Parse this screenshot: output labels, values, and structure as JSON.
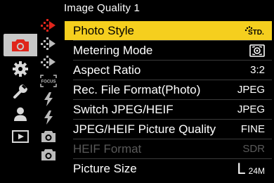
{
  "header": {
    "title": "Image Quality 1"
  },
  "tabs": [
    {
      "icon": "camera-icon",
      "active": true
    },
    {
      "icon": "gear-icon",
      "active": false
    },
    {
      "icon": "wrench-icon",
      "active": false
    },
    {
      "icon": "person-icon",
      "active": false
    },
    {
      "icon": "playback-icon",
      "active": false
    }
  ],
  "menu": {
    "items": [
      {
        "label": "Photo Style",
        "value_icon": "photo-style-standard-icon",
        "value": "STD.",
        "selected": true,
        "disabled": false
      },
      {
        "label": "Metering Mode",
        "value_icon": "multi-metering-icon",
        "value": "",
        "selected": false,
        "disabled": false
      },
      {
        "label": "Aspect Ratio",
        "value": "3:2",
        "selected": false,
        "disabled": false
      },
      {
        "label": "Rec. File Format(Photo)",
        "value": "JPEG",
        "selected": false,
        "disabled": false
      },
      {
        "label": "Switch JPEG/HEIF",
        "value": "JPEG",
        "selected": false,
        "disabled": false
      },
      {
        "label": "JPEG/HEIF Picture Quality",
        "value": "FINE",
        "selected": false,
        "disabled": false
      },
      {
        "label": "HEIF Format",
        "value": "SDR",
        "selected": false,
        "disabled": true
      },
      {
        "label": "Picture Size",
        "value_large": "L",
        "value_small": "24M",
        "selected": false,
        "disabled": false
      }
    ]
  },
  "sidebar_subicons": [
    {
      "icon": "photo-style-icon"
    },
    {
      "icon": "image-quality-icon"
    },
    {
      "icon": "image-quality-icon"
    },
    {
      "icon": "focus-icon"
    },
    {
      "icon": "flash-icon"
    },
    {
      "icon": "flash-icon"
    },
    {
      "icon": "camera-body-icon"
    },
    {
      "icon": "camera-body-icon"
    }
  ],
  "colors": {
    "accent_red": "#e0251b",
    "selection_yellow": "#f5cf1e",
    "tab_active_bg": "#c8c8c8",
    "disabled_text": "#5a5a5a"
  }
}
